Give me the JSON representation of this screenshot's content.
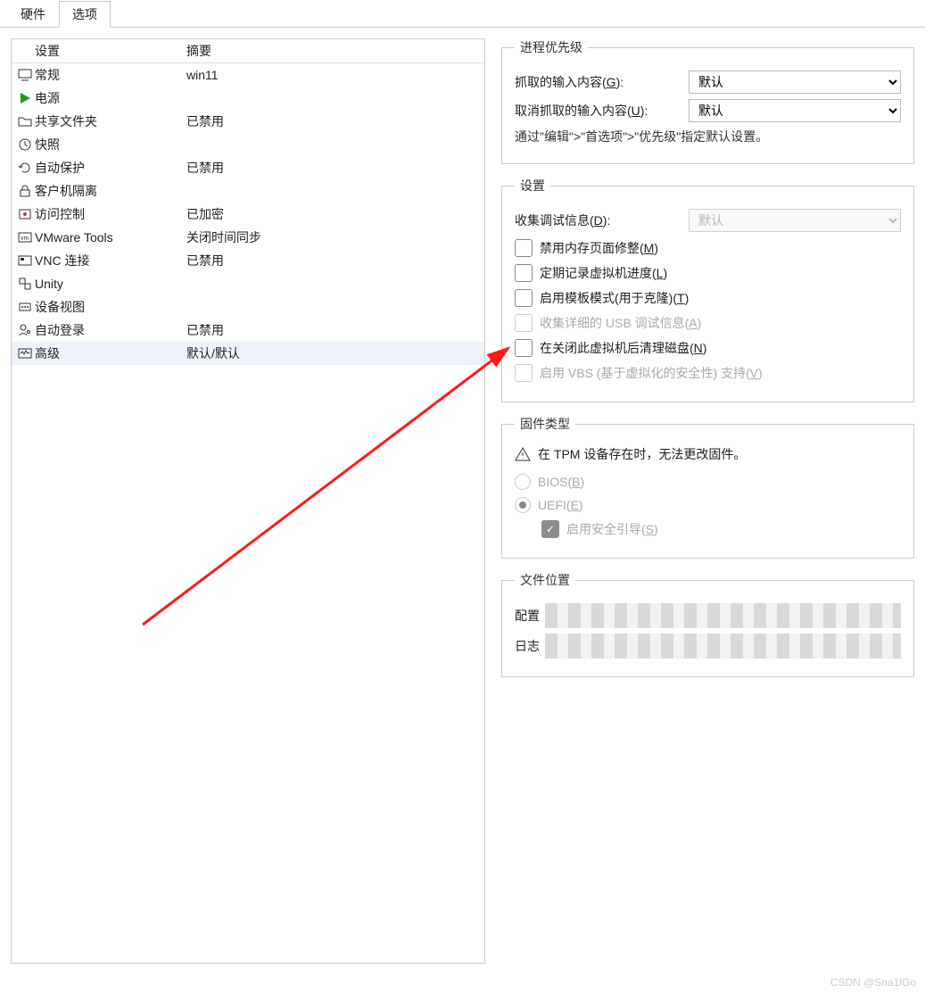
{
  "tabs": {
    "hardware": "硬件",
    "options": "选项"
  },
  "left": {
    "header_setting": "设置",
    "header_summary": "摘要",
    "rows": [
      {
        "label": "常规",
        "summary": "win11"
      },
      {
        "label": "电源",
        "summary": ""
      },
      {
        "label": "共享文件夹",
        "summary": "已禁用"
      },
      {
        "label": "快照",
        "summary": ""
      },
      {
        "label": "自动保护",
        "summary": "已禁用"
      },
      {
        "label": "客户机隔离",
        "summary": ""
      },
      {
        "label": "访问控制",
        "summary": "已加密"
      },
      {
        "label": "VMware Tools",
        "summary": "关闭时间同步"
      },
      {
        "label": "VNC 连接",
        "summary": "已禁用"
      },
      {
        "label": "Unity",
        "summary": ""
      },
      {
        "label": "设备视图",
        "summary": ""
      },
      {
        "label": "自动登录",
        "summary": "已禁用"
      },
      {
        "label": "高级",
        "summary": "默认/默认"
      }
    ]
  },
  "priority": {
    "legend": "进程优先级",
    "grab_label": "抓取的输入内容(",
    "grab_key": "G",
    "grab_suffix": "):",
    "ungrab_label": "取消抓取的输入内容(",
    "ungrab_key": "U",
    "ungrab_suffix": "):",
    "default_opt": "默认",
    "hint": "通过\"编辑\">\"首选项\">\"优先级\"指定默认设置。"
  },
  "settings": {
    "legend": "设置",
    "debug_label": "收集调试信息(",
    "debug_key": "D",
    "debug_suffix": "):",
    "debug_opt": "默认",
    "chk_mem": "禁用内存页面修整(",
    "chk_mem_key": "M",
    "chk_mem_suf": ")",
    "chk_log": "定期记录虚拟机进度(",
    "chk_log_key": "L",
    "chk_log_suf": ")",
    "chk_tpl": "启用模板模式(用于克隆)(",
    "chk_tpl_key": "T",
    "chk_tpl_suf": ")",
    "chk_usb": "收集详细的 USB 调试信息(",
    "chk_usb_key": "A",
    "chk_usb_suf": ")",
    "chk_clean": "在关闭此虚拟机后清理磁盘(",
    "chk_clean_key": "N",
    "chk_clean_suf": ")",
    "chk_vbs": "启用 VBS (基于虚拟化的安全性) 支持(",
    "chk_vbs_key": "V",
    "chk_vbs_suf": ")"
  },
  "firmware": {
    "legend": "固件类型",
    "warn": "在 TPM 设备存在时，无法更改固件。",
    "bios": "BIOS(",
    "bios_key": "B",
    "bios_suf": ")",
    "uefi": "UEFI(",
    "uefi_key": "E",
    "uefi_suf": ")",
    "secure": "启用安全引导(",
    "secure_key": "S",
    "secure_suf": ")"
  },
  "fileloc": {
    "legend": "文件位置",
    "config": "配置",
    "log": "日志"
  },
  "watermark": "CSDN @Sna1lGo"
}
